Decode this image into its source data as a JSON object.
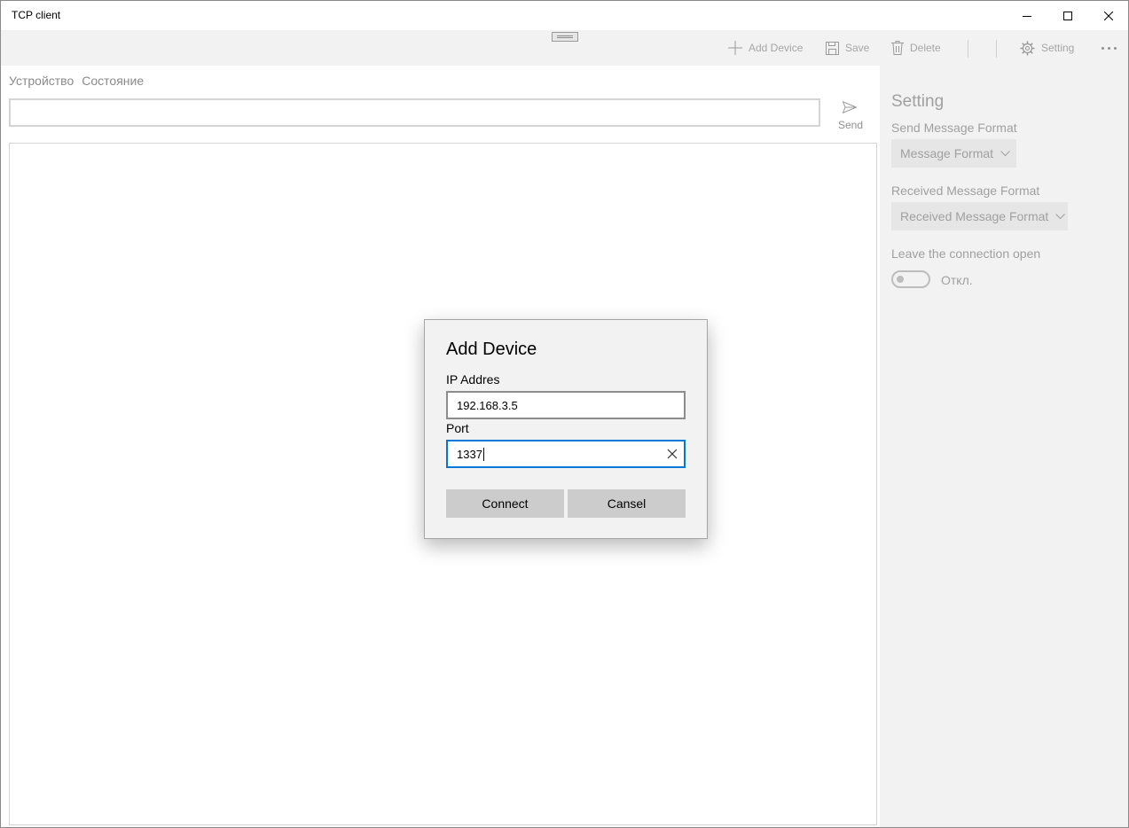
{
  "window": {
    "title": "TCP client"
  },
  "command_bar": {
    "add_device_label": "Add Device",
    "save_label": "Save",
    "delete_label": "Delete",
    "setting_label": "Setting"
  },
  "main": {
    "tabs": [
      {
        "label": "Устройство"
      },
      {
        "label": "Состояние"
      }
    ],
    "message_input": {
      "value": "",
      "placeholder": ""
    },
    "send_label": "Send"
  },
  "settings": {
    "title": "Setting",
    "send_format_label": "Send Message Format",
    "send_format_value": "Message Format",
    "received_format_label": "Received Message Format",
    "received_format_value": "Received Message Format",
    "keep_open_label": "Leave the connection open",
    "keep_open_state": "Откл.",
    "keep_open_on": false
  },
  "dialog": {
    "title": "Add Device",
    "ip_label": "IP Addres",
    "ip_value": "192.168.3.5",
    "port_label": "Port",
    "port_value": "1337",
    "connect_label": "Connect",
    "cancel_label": "Cansel"
  },
  "colors": {
    "accent": "#0078d7",
    "command_bar_bg": "#f2f2f2",
    "disabled_text": "#a0a0a0",
    "dialog_button_bg": "#cccccc"
  }
}
